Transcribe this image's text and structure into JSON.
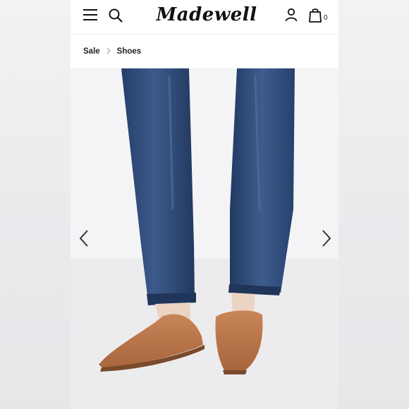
{
  "header": {
    "logo_text": "Madewell",
    "bag_count": "0",
    "icons": {
      "menu": "hamburger-menu-icon",
      "search": "search-icon",
      "account": "user-icon",
      "bag": "shopping-bag-icon"
    }
  },
  "breadcrumb": {
    "items": [
      "Sale",
      "Shoes"
    ],
    "separator_icon": "chevron-right-icon"
  },
  "product_image": {
    "description_icon": "product-photo",
    "carousel": {
      "prev_icon": "chevron-left-icon",
      "next_icon": "chevron-right-icon"
    }
  },
  "colors": {
    "denim": "#2f4a78",
    "shoe_leather": "#b8734a",
    "text": "#111111"
  }
}
